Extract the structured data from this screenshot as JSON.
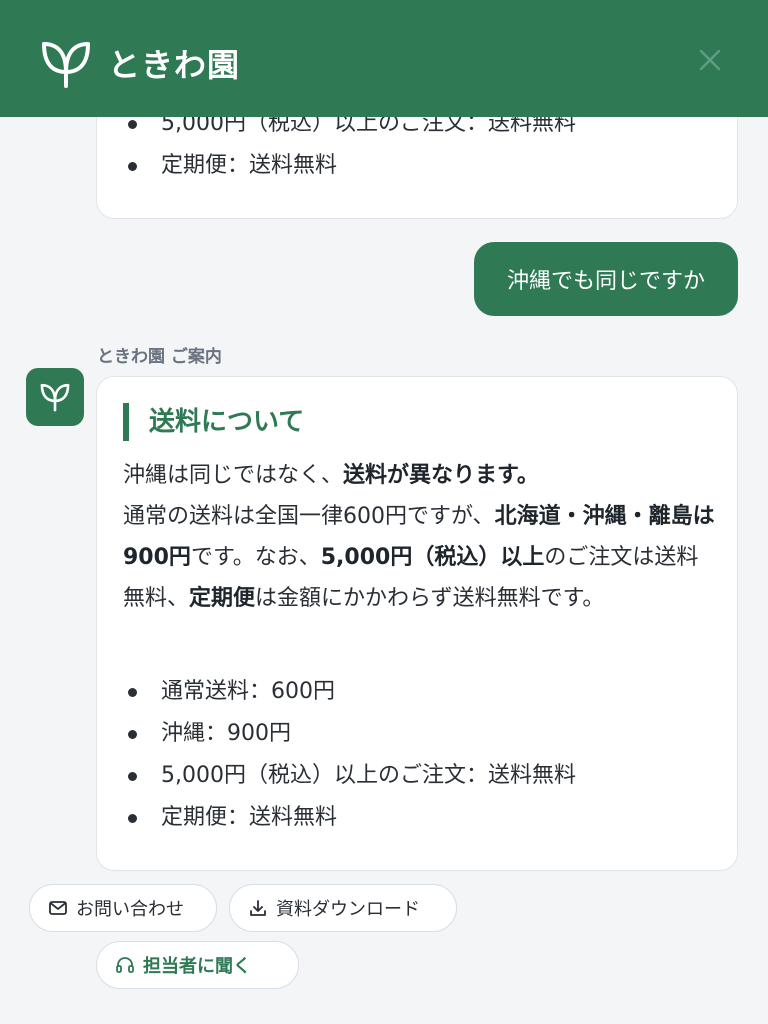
{
  "header": {
    "brand_name": "ときわ園",
    "logo_icon": "sprout-icon",
    "close_icon": "close-icon"
  },
  "previous_bot_message": {
    "bullets": [
      "5,000円（税込）以上のご注文：送料無料",
      "定期便：送料無料"
    ]
  },
  "user_message": {
    "text": "沖縄でも同じですか"
  },
  "bot_message": {
    "sender_label": "ときわ園 ご案内",
    "title": "送料について",
    "paragraph": {
      "s1": "沖縄は同じではなく、",
      "s1_bold": "送料が異なります。",
      "s2": "通常の送料は全国一律600円ですが、",
      "s2_bold": "北海道・沖縄・離島は900円",
      "s3": "です。なお、",
      "s3_bold": "5,000円（税込）以上",
      "s4": "のご注文は送料無料、",
      "s4_bold": "定期便",
      "s5": "は金額にかかわらず送料無料です。"
    },
    "bullets": [
      "通常送料：600円",
      "沖縄：900円",
      "5,000円（税込）以上のご注文：送料無料",
      "定期便：送料無料"
    ]
  },
  "actions": {
    "contact_label": "お問い合わせ",
    "download_label": "資料ダウンロード",
    "agent_label": "担当者に聞く"
  },
  "colors": {
    "brand_green": "#2f7a55",
    "background": "#f3f5f7",
    "card": "#ffffff"
  }
}
